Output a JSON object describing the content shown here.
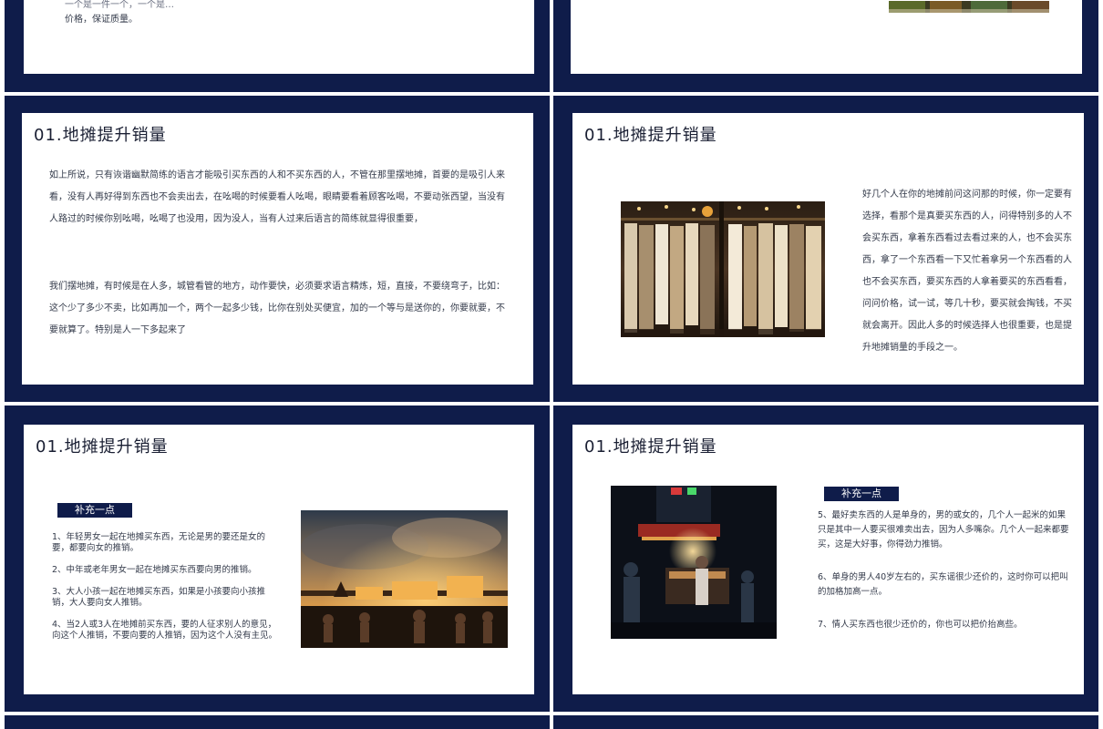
{
  "colors": {
    "navy": "#0f1c4a",
    "card": "#ffffff",
    "text": "#333a4a",
    "title": "#1a1f33"
  },
  "slides": {
    "top_left": {
      "text_line1": "一个是一件一个，一个是…",
      "text_line2": "价格，保证质量。"
    },
    "s1": {
      "title": "01.地摊提升销量",
      "para1": "如上所说，只有诙谐幽默简练的语言才能吸引买东西的人和不买东西的人，不管在那里摆地摊，首要的是吸引人来看，没有人再好得到东西也不会卖出去，在吆喝的时候要看人吆喝，眼睛要看着顾客吆喝，不要动张西望，当没有人路过的时候你别吆喝，吆喝了也没用，因为没人，当有人过来后语言的简练就显得很重要，",
      "para2": "我们摆地摊，有时候是在人多，城管看管的地方，动作要快，必须要求语言精炼，短，直接，不要绕弯子，比如：这个少了多少不卖，比如再加一个，两个一起多少钱，比你在别处买便宜，加的一个等与是送你的，你要就要，不要就算了。特别是人一下多起来了"
    },
    "s2": {
      "title": "01.地摊提升销量",
      "para": "好几个人在你的地摊前问这问那的时候，你一定要有选择，看那个是真要买东西的人，问得特别多的人不会买东西，拿着东西看过去看过来的人，也不会买东西，拿了一个东西看一下又忙着拿另一个东西看的人也不会买东西，要买东西的人拿着要买的东西看看，问问价格，试一试，等几十秒，要买就会掏钱，不买就会离开。因此人多的时候选择人也很重要，也是提升地摊销量的手段之一。"
    },
    "s3": {
      "title": "01.地摊提升销量",
      "badge": "补充一点",
      "items": [
        "1、年轻男女一起在地摊买东西，无论是男的要还是女的要，都要向女的推销。",
        "2、中年或老年男女一起在地摊买东西要向男的推销。",
        "3、大人小孩一起在地摊买东西，如果是小孩要向小孩推销，大人要向女人推销。",
        "4、当2人或3人在地摊前买东西，要的人征求别人的意见，向这个人推销，不要向要的人推销，因为这个人没有主见。"
      ]
    },
    "s4": {
      "title": "01.地摊提升销量",
      "badge": "补充一点",
      "items": [
        "5、最好卖东西的人是单身的，男的或女的，几个人一起米的如果只是其中一人要买很难卖出去，因为人多嘴杂。几个人一起来都要买，这是大好事，你得劲力推销。",
        "6、单身的男人40岁左右的，买东谣很少还价的，这时你可以把叫的加格加高一点。",
        "7、情人买东西也很少还价的，你也可以把价抬高些。"
      ]
    }
  }
}
